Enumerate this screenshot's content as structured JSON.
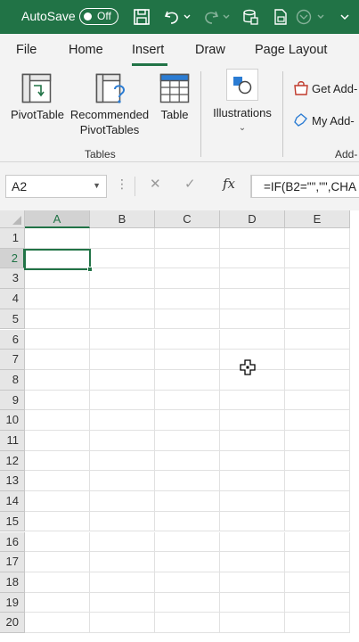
{
  "titlebar": {
    "autosave_label": "AutoSave",
    "autosave_state": "Off",
    "icons": [
      "save-icon",
      "undo-icon",
      "redo-icon",
      "table-icon",
      "form-icon",
      "brush-icon"
    ],
    "background": "#217346"
  },
  "tabs": [
    {
      "label": "File"
    },
    {
      "label": "Home"
    },
    {
      "label": "Insert",
      "active": true
    },
    {
      "label": "Draw"
    },
    {
      "label": "Page Layout"
    }
  ],
  "ribbon": {
    "tables_group": {
      "label": "Tables",
      "buttons": [
        {
          "label": "PivotTable",
          "icon": "pivottable-icon"
        },
        {
          "label": "Recommended PivotTables",
          "line1": "Recommended",
          "line2": "PivotTables",
          "icon": "recommended-pivottables-icon"
        },
        {
          "label": "Table",
          "icon": "table-icon"
        }
      ]
    },
    "illustrations": {
      "label": "Illustrations",
      "icon": "shapes-icon"
    },
    "addins_group": {
      "label": "Add-",
      "get_addins": "Get Add-",
      "my_addins": "My Add-"
    }
  },
  "formula_bar": {
    "name_box": "A2",
    "formula": "=IF(B2=\"\",\"\",CHA",
    "fx_label": "fx"
  },
  "grid": {
    "columns": [
      "A",
      "B",
      "C",
      "D",
      "E"
    ],
    "rows": [
      "1",
      "2",
      "3",
      "4",
      "5",
      "6",
      "7",
      "8",
      "9",
      "10",
      "11",
      "12",
      "13",
      "14",
      "15",
      "16",
      "17",
      "18",
      "19",
      "20"
    ],
    "active_cell": "A2",
    "accent": "#217346"
  }
}
